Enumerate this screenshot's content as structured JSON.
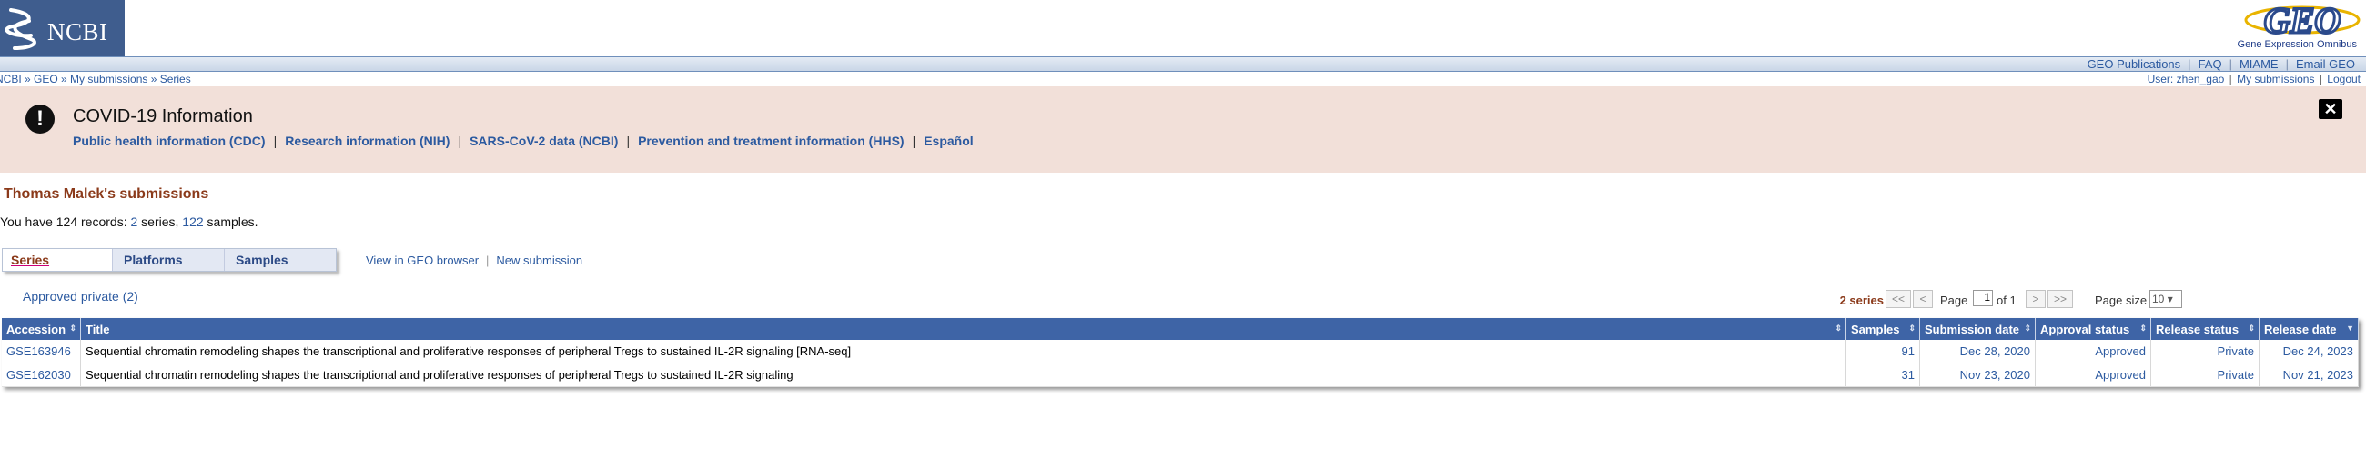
{
  "header": {
    "logo_text": "NCBI",
    "geo_logo_text": "GEO",
    "geo_tagline": "Gene Expression Omnibus",
    "nav": [
      "GEO Publications",
      "FAQ",
      "MIAME",
      "Email GEO"
    ],
    "breadcrumb": "NCBI » GEO » My submissions » Series",
    "user": "User: zhen_gao",
    "user_links": [
      "My submissions",
      "Logout"
    ]
  },
  "banner": {
    "title": "COVID-19 Information",
    "links": [
      "Public health information (CDC)",
      "Research information (NIH)",
      "SARS-CoV-2 data (NCBI)",
      "Prevention and treatment information (HHS)",
      "Español"
    ],
    "close_icon": "close-icon",
    "alert_icon": "exclamation-icon"
  },
  "page": {
    "title": "Thomas Malek's submissions",
    "records_prefix": "You have 124 records: ",
    "series_count": "2",
    "records_mid": " series, ",
    "samples_count": "122",
    "records_suffix": " samples."
  },
  "tabs": [
    "Series",
    "Platforms",
    "Samples"
  ],
  "active_tab": "Series",
  "tab_links": [
    "View in GEO browser",
    "New submission"
  ],
  "filter_link": "Approved private (2)",
  "pager": {
    "count_label": "2 series",
    "first": "<<",
    "prev": "<",
    "page_label": "Page",
    "page_value": "1",
    "of_label": "of 1",
    "next": ">",
    "last": ">>",
    "size_label": "Page size",
    "size_value": "10"
  },
  "table": {
    "columns": [
      "Accession",
      "Title",
      "Samples",
      "Submission date",
      "Approval status",
      "Release status",
      "Release date"
    ],
    "rows": [
      [
        "GSE163946",
        "Sequential chromatin remodeling shapes the transcriptional and proliferative responses of peripheral Tregs to sustained IL-2R signaling [RNA-seq]",
        "91",
        "Dec 28, 2020",
        "Approved",
        "Private",
        "Dec 24, 2023"
      ],
      [
        "GSE162030",
        "Sequential chromatin remodeling shapes the transcriptional and proliferative responses of peripheral Tregs to sustained IL-2R signaling",
        "31",
        "Nov 23, 2020",
        "Approved",
        "Private",
        "Nov 21, 2023"
      ]
    ]
  },
  "colors": {
    "ncbi_blue": "#3f5d8e",
    "banner_bg": "#f2e0d9",
    "title_brown": "#8b3a1a",
    "table_header": "#3e64a6",
    "link": "#2c5aa0"
  }
}
